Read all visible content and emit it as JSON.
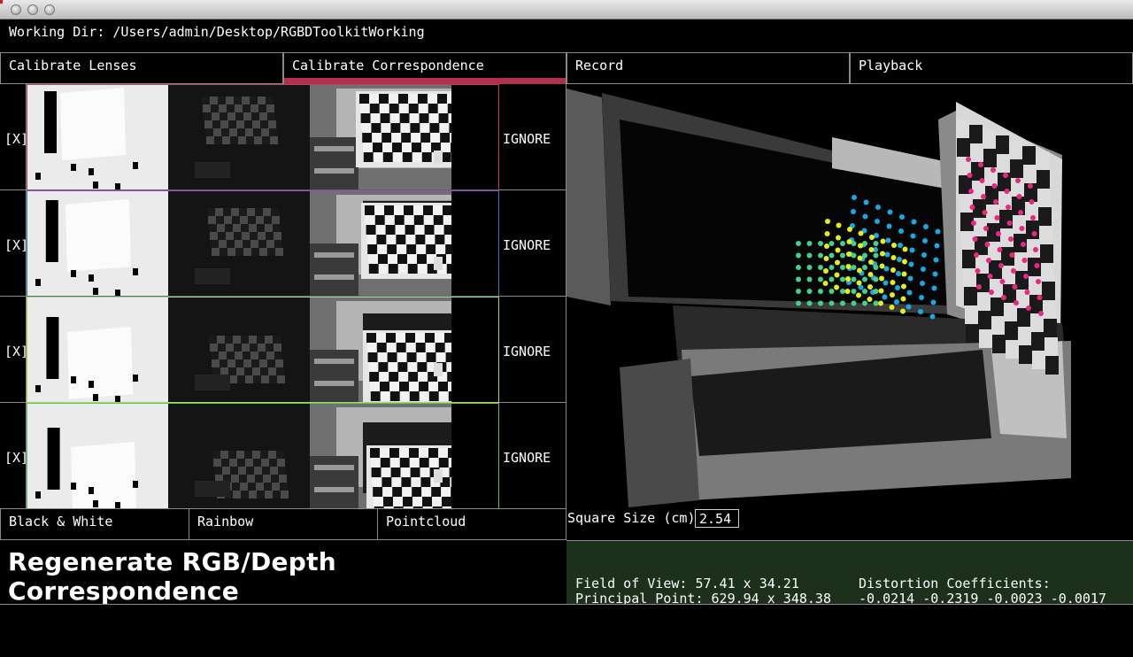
{
  "working_dir": "Working Dir: /Users/admin/Desktop/RGBDToolkitWorking",
  "tabs": [
    "Calibrate Lenses",
    "Calibrate Correspondence",
    "Record",
    "Playback"
  ],
  "active_tab": "Calibrate Correspondence",
  "pairs": [
    {
      "toggle": "[X]",
      "ignore": "IGNORE",
      "color": "#c2386a"
    },
    {
      "toggle": "[X]",
      "ignore": "IGNORE",
      "color": "#2f7fbf"
    },
    {
      "toggle": "[X]",
      "ignore": "IGNORE",
      "color": "#c5d33a"
    },
    {
      "toggle": "[X]",
      "ignore": "IGNORE",
      "color": "#56c47a"
    }
  ],
  "view_modes": [
    "Black & White",
    "Rainbow",
    "Pointcloud"
  ],
  "regenerate_label": "Regenerate RGB/Depth Correspondence",
  "square_size": {
    "label": "Square Size (cm)",
    "value": "2.54"
  },
  "stats": {
    "fov": "Field of View: 57.41 x 34.21",
    "principal": "Principal Point: 629.94 x 348.38",
    "distortion_label": "Distortion Coefficients:",
    "distortion_values": "-0.0214 -0.2319 -0.0023 -0.0017"
  }
}
